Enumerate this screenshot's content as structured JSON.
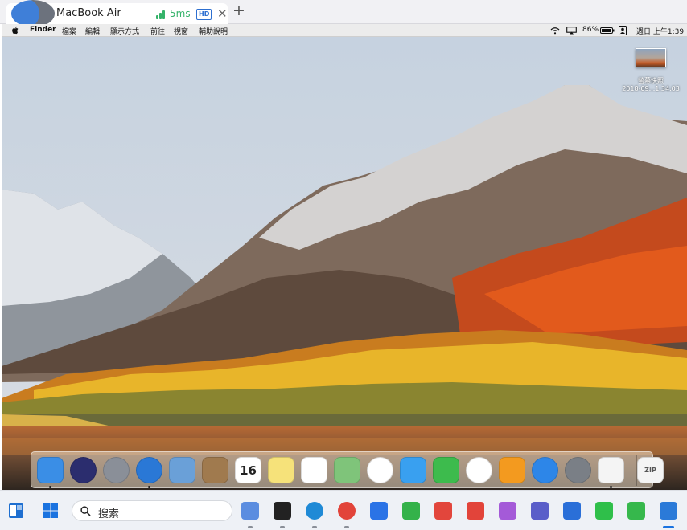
{
  "tab": {
    "title": "MacBook Air",
    "latency": "5ms",
    "quality_badge": "HD",
    "close_glyph": "✕",
    "new_tab_glyph": "+"
  },
  "menubar": {
    "app": "Finder",
    "items": [
      "檔案",
      "編輯",
      "顯示方式",
      "前往",
      "視窗",
      "輔助說明"
    ],
    "battery": "86%",
    "datetime": "週日 上午1:39"
  },
  "desktop": {
    "screenshot_label_line1": "螢幕快照",
    "screenshot_label_line2": "2018-09...1.34.03"
  },
  "dock": {
    "items": [
      {
        "name": "Finder",
        "icon": "finder-icon",
        "color": "#3a8ee6"
      },
      {
        "name": "Siri",
        "icon": "siri-icon",
        "color": "#2b2d6e"
      },
      {
        "name": "Launchpad",
        "icon": "launchpad-icon",
        "color": "#8a8f98"
      },
      {
        "name": "Safari",
        "icon": "safari-icon",
        "color": "#2a78d6"
      },
      {
        "name": "Mail",
        "icon": "mail-icon",
        "color": "#6aa0d8"
      },
      {
        "name": "Contacts",
        "icon": "contacts-icon",
        "color": "#a07a4e"
      },
      {
        "name": "Calendar",
        "icon": "calendar-icon",
        "color": "#ffffff",
        "text": "16"
      },
      {
        "name": "Notes",
        "icon": "notes-icon",
        "color": "#f6e27a"
      },
      {
        "name": "Reminders",
        "icon": "reminders-icon",
        "color": "#ffffff"
      },
      {
        "name": "Maps",
        "icon": "maps-icon",
        "color": "#7fc47a"
      },
      {
        "name": "Photos",
        "icon": "photos-icon",
        "color": "#ffffff"
      },
      {
        "name": "Messages",
        "icon": "messages-icon",
        "color": "#39a0f0"
      },
      {
        "name": "FaceTime",
        "icon": "facetime-icon",
        "color": "#3dbb4d"
      },
      {
        "name": "iTunes",
        "icon": "itunes-icon",
        "color": "#ffffff"
      },
      {
        "name": "iBooks",
        "icon": "ibooks-icon",
        "color": "#f39a1f"
      },
      {
        "name": "App Store",
        "icon": "appstore-icon",
        "color": "#2d86e8"
      },
      {
        "name": "System Preferences",
        "icon": "system-preferences-icon",
        "color": "#7a7f86"
      },
      {
        "name": "TextEdit",
        "icon": "textedit-icon",
        "color": "#f4f4f4"
      },
      {
        "name": "Zip Archive",
        "icon": "zip-file-icon",
        "color": "#f4f4f4",
        "text": "ZIP"
      }
    ],
    "running": [
      0,
      3,
      17
    ]
  },
  "taskbar": {
    "search_placeholder": "搜索",
    "apps": [
      {
        "icon": "copilot-icon",
        "color": "#5b8de0"
      },
      {
        "icon": "task-view-icon",
        "color": "#222222"
      },
      {
        "icon": "edge-icon",
        "color": "#1f8ad6"
      },
      {
        "icon": "chrome-icon",
        "color": "#e2443a"
      },
      {
        "icon": "feishu-icon",
        "color": "#2a73e6"
      },
      {
        "icon": "shopping-bag-icon",
        "color": "#34b24a"
      },
      {
        "icon": "cat-app-icon",
        "color": "#e2463c"
      },
      {
        "icon": "wps-icon",
        "color": "#e2443a"
      },
      {
        "icon": "kitten-app-icon",
        "color": "#a45ad8"
      },
      {
        "icon": "teams-icon",
        "color": "#5a5ec9"
      },
      {
        "icon": "cube-app-icon",
        "color": "#2a6fd8"
      },
      {
        "icon": "wechat-icon",
        "color": "#2fbf4a"
      },
      {
        "icon": "chat-bubble-icon",
        "color": "#36b84c"
      },
      {
        "icon": "remote-desktop-icon",
        "color": "#2b7ad8"
      }
    ]
  }
}
